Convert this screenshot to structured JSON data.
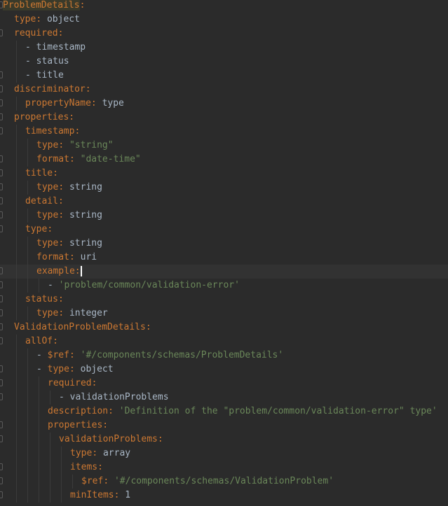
{
  "editor": {
    "language": "yaml",
    "colors": {
      "background": "#2b2b2b",
      "key": "#cc7832",
      "plain_value": "#a9b7c6",
      "string_value": "#6a8759",
      "number_value": "#6897bb",
      "current_line": "#323232"
    },
    "cursor_line_index": 19,
    "lines": [
      {
        "indent": 0,
        "dash": false,
        "key": "ProblemDetails",
        "colon": true,
        "value": "",
        "vtype": "none",
        "fold": true,
        "highlight": true
      },
      {
        "indent": 1,
        "dash": false,
        "key": "type",
        "colon": true,
        "value": "object",
        "vtype": "plain",
        "fold": false
      },
      {
        "indent": 1,
        "dash": false,
        "key": "required",
        "colon": true,
        "value": "",
        "vtype": "none",
        "fold": true
      },
      {
        "indent": 2,
        "dash": true,
        "key": "",
        "colon": false,
        "value": "timestamp",
        "vtype": "plain",
        "fold": false
      },
      {
        "indent": 2,
        "dash": true,
        "key": "",
        "colon": false,
        "value": "status",
        "vtype": "plain",
        "fold": false
      },
      {
        "indent": 2,
        "dash": true,
        "key": "",
        "colon": false,
        "value": "title",
        "vtype": "plain",
        "fold": true
      },
      {
        "indent": 1,
        "dash": false,
        "key": "discriminator",
        "colon": true,
        "value": "",
        "vtype": "none",
        "fold": true
      },
      {
        "indent": 2,
        "dash": false,
        "key": "propertyName",
        "colon": true,
        "value": "type",
        "vtype": "plain",
        "fold": true
      },
      {
        "indent": 1,
        "dash": false,
        "key": "properties",
        "colon": true,
        "value": "",
        "vtype": "none",
        "fold": true
      },
      {
        "indent": 2,
        "dash": false,
        "key": "timestamp",
        "colon": true,
        "value": "",
        "vtype": "none",
        "fold": true
      },
      {
        "indent": 3,
        "dash": false,
        "key": "type",
        "colon": true,
        "value": "\"string\"",
        "vtype": "string",
        "fold": false
      },
      {
        "indent": 3,
        "dash": false,
        "key": "format",
        "colon": true,
        "value": "\"date-time\"",
        "vtype": "string",
        "fold": true
      },
      {
        "indent": 2,
        "dash": false,
        "key": "title",
        "colon": true,
        "value": "",
        "vtype": "none",
        "fold": true
      },
      {
        "indent": 3,
        "dash": false,
        "key": "type",
        "colon": true,
        "value": "string",
        "vtype": "plain",
        "fold": true
      },
      {
        "indent": 2,
        "dash": false,
        "key": "detail",
        "colon": true,
        "value": "",
        "vtype": "none",
        "fold": true
      },
      {
        "indent": 3,
        "dash": false,
        "key": "type",
        "colon": true,
        "value": "string",
        "vtype": "plain",
        "fold": true
      },
      {
        "indent": 2,
        "dash": false,
        "key": "type",
        "colon": true,
        "value": "",
        "vtype": "none",
        "fold": true
      },
      {
        "indent": 3,
        "dash": false,
        "key": "type",
        "colon": true,
        "value": "string",
        "vtype": "plain",
        "fold": false
      },
      {
        "indent": 3,
        "dash": false,
        "key": "format",
        "colon": true,
        "value": "uri",
        "vtype": "plain",
        "fold": false
      },
      {
        "indent": 3,
        "dash": false,
        "key": "example",
        "colon": true,
        "value": "",
        "vtype": "none",
        "fold": true
      },
      {
        "indent": 4,
        "dash": true,
        "key": "",
        "colon": false,
        "value": "'problem/common/validation-error'",
        "vtype": "string",
        "fold": true
      },
      {
        "indent": 2,
        "dash": false,
        "key": "status",
        "colon": true,
        "value": "",
        "vtype": "none",
        "fold": true
      },
      {
        "indent": 3,
        "dash": false,
        "key": "type",
        "colon": true,
        "value": "integer",
        "vtype": "plain",
        "fold": true
      },
      {
        "indent": 1,
        "dash": false,
        "key": "ValidationProblemDetails",
        "colon": true,
        "value": "",
        "vtype": "none",
        "fold": true
      },
      {
        "indent": 2,
        "dash": false,
        "key": "allOf",
        "colon": true,
        "value": "",
        "vtype": "none",
        "fold": true
      },
      {
        "indent": 3,
        "dash": true,
        "key": "$ref",
        "colon": true,
        "value": "'#/components/schemas/ProblemDetails'",
        "vtype": "string",
        "fold": false
      },
      {
        "indent": 3,
        "dash": true,
        "key": "type",
        "colon": true,
        "value": "object",
        "vtype": "plain",
        "fold": true
      },
      {
        "indent": 4,
        "dash": false,
        "key": "required",
        "colon": true,
        "value": "",
        "vtype": "none",
        "fold": true
      },
      {
        "indent": 5,
        "dash": true,
        "key": "",
        "colon": false,
        "value": "validationProblems",
        "vtype": "plain",
        "fold": true
      },
      {
        "indent": 4,
        "dash": false,
        "key": "description",
        "colon": true,
        "value": "'Definition of the \"problem/common/validation-error\" type'",
        "vtype": "string",
        "fold": false
      },
      {
        "indent": 4,
        "dash": false,
        "key": "properties",
        "colon": true,
        "value": "",
        "vtype": "none",
        "fold": true
      },
      {
        "indent": 5,
        "dash": false,
        "key": "validationProblems",
        "colon": true,
        "value": "",
        "vtype": "none",
        "fold": true
      },
      {
        "indent": 6,
        "dash": false,
        "key": "type",
        "colon": true,
        "value": "array",
        "vtype": "plain",
        "fold": false
      },
      {
        "indent": 6,
        "dash": false,
        "key": "items",
        "colon": true,
        "value": "",
        "vtype": "none",
        "fold": true
      },
      {
        "indent": 7,
        "dash": false,
        "key": "$ref",
        "colon": true,
        "value": "'#/components/schemas/ValidationProblem'",
        "vtype": "string",
        "fold": true
      },
      {
        "indent": 6,
        "dash": false,
        "key": "minItems",
        "colon": true,
        "value": "1",
        "vtype": "plain",
        "fold": true
      }
    ]
  }
}
